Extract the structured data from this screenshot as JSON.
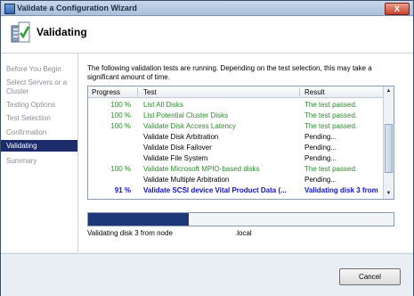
{
  "window": {
    "title": "Validate a Configuration Wizard",
    "close_label": "X"
  },
  "header": {
    "title": "Validating"
  },
  "sidebar": {
    "items": [
      {
        "label": "Before You Begin"
      },
      {
        "label": "Select Servers or a Cluster"
      },
      {
        "label": "Testing Options"
      },
      {
        "label": "Test Selection"
      },
      {
        "label": "Confirmation"
      },
      {
        "label": "Validating",
        "selected": true
      },
      {
        "label": "Summary"
      }
    ]
  },
  "main": {
    "intro": "The following validation tests are running. Depending on the test selection, this may take a significant amount of time.",
    "table": {
      "columns": [
        "Progress",
        "Test",
        "Result"
      ],
      "rows": [
        {
          "progress": "100 %",
          "test": "List All Disks",
          "result": "The test passed.",
          "state": "pass"
        },
        {
          "progress": "100 %",
          "test": "List Potential Cluster Disks",
          "result": "The test passed.",
          "state": "pass"
        },
        {
          "progress": "100 %",
          "test": "Validate Disk Access Latency",
          "result": "The test passed.",
          "state": "pass"
        },
        {
          "progress": "",
          "test": "Validate Disk Arbitration",
          "result": "Pending...",
          "state": "pending"
        },
        {
          "progress": "",
          "test": "Validate Disk Failover",
          "result": "Pending...",
          "state": "pending"
        },
        {
          "progress": "",
          "test": "Validate File System",
          "result": "Pending...",
          "state": "pending"
        },
        {
          "progress": "100 %",
          "test": "Validate Microsoft MPIO-based disks",
          "result": "The test passed.",
          "state": "pass"
        },
        {
          "progress": "",
          "test": "Validate Multiple Arbitration",
          "result": "Pending...",
          "state": "pending"
        },
        {
          "progress": "91 %",
          "test": "Validate SCSI device Vital Product Data (...",
          "result": "Validating disk 3 from",
          "state": "running"
        }
      ]
    },
    "progress_fraction": 0.33,
    "status_text": "Validating disk 3 from node",
    "status_node": ".local"
  },
  "footer": {
    "cancel_label": "Cancel"
  },
  "colors": {
    "pass": "#2e8b2e",
    "running": "#1010c8",
    "selected": "#1d2d6b",
    "progress": "#1d3778"
  }
}
